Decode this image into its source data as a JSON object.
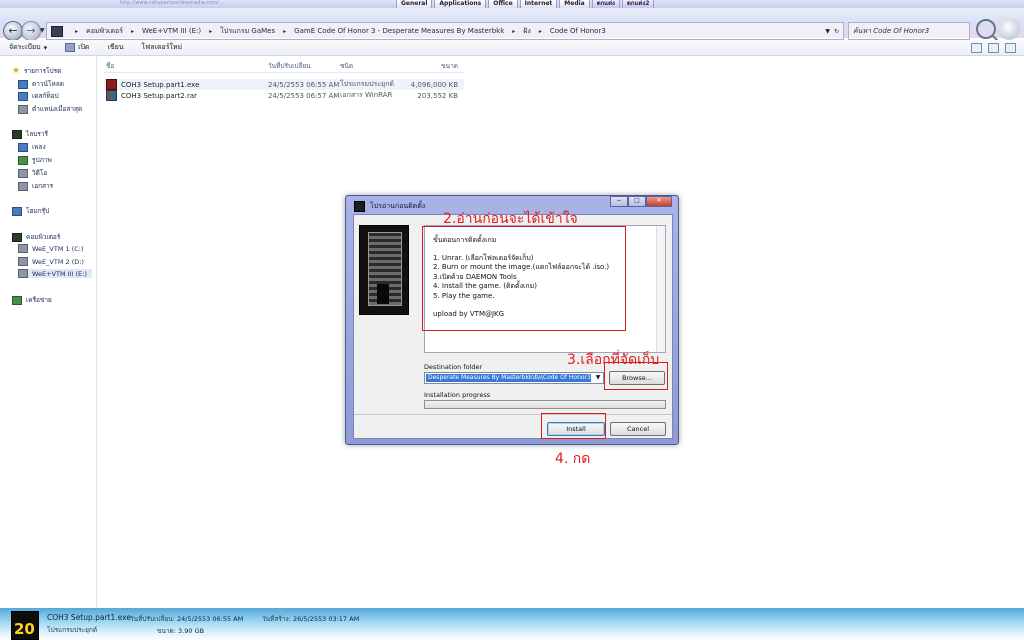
{
  "bookmarks": {
    "faint_text": "http://www.cdhypertoonlinemedia.com/...",
    "tabs": [
      "General",
      "Applications",
      "Office",
      "Internet",
      "Media",
      "ตกแต่ง",
      "ตกแต่ง2"
    ]
  },
  "address_bar": {
    "crumbs": [
      "คอมพิวเตอร์",
      "WeE+VTM III (E:)",
      "โปรแกรม GaMes",
      "GamE Code Of Honor 3 - Desperate Measures By Masterbkk",
      "ฝัง",
      "Code Of Honor3"
    ],
    "search_placeholder": "ค้นหา Code Of Honor3"
  },
  "toolbar": {
    "organize": "จัดระเบียบ",
    "open": "เปิด",
    "burn": "เขียน",
    "new_folder": "โฟลเดอร์ใหม่"
  },
  "nav": {
    "favorites": "รายการโปรด",
    "downloads": "ดาวน์โหลด",
    "desktop": "เดสก์ท็อป",
    "recent": "ตำแหน่งเมื่อล่าสุด",
    "libraries": "ไลบรารี",
    "music": "เพลง",
    "pictures": "รูปภาพ",
    "videos": "วิดีโอ",
    "documents": "เอกสาร",
    "homegroup": "โฮมกรุ๊ป",
    "computer": "คอมพิวเตอร์",
    "drive_c": "WeE_VTM 1 (C:)",
    "drive_d": "WeE_VTM 2 (D:)",
    "drive_e": "WeE+VTM III (E:)",
    "network": "เครือข่าย"
  },
  "file_list": {
    "headers": {
      "name": "ชื่อ",
      "date": "วันที่ปรับเปลี่ยน",
      "type": "ชนิด",
      "size": "ขนาด"
    },
    "rows": [
      {
        "name": "COH3 Setup.part1.exe",
        "date": "24/5/2553 06:55 AM",
        "type": "โปรแกรมประยุกต์",
        "size": "4,096,000 KB"
      },
      {
        "name": "COH3 Setup.part2.rar",
        "date": "24/5/2553 06:57 AM",
        "type": "เอกสาร WinRAR",
        "size": "203,552 KB"
      }
    ]
  },
  "dialog": {
    "title": "โปรอ่านก่อนติดตั้ง",
    "readme": {
      "heading": "ขั้นตอนการติดตั้งเกม",
      "steps": [
        "1. Unrar. (เลือกโฟลเดอร์จัดเก็บ)",
        "2. Burn or mount the image.(แตกไฟล์ออกจะได้ .iso.)",
        "3.เปิดด้วย DAEMON Tools",
        "4. Install the game. (ติดตั้งเกม)",
        "5. Play the game."
      ],
      "upload": "upload by VTM@JKG"
    },
    "destination_label": "Destination folder",
    "destination_value": "Desperate Measures By Masterbkk\\ฝัง\\Code Of Honor3",
    "browse_label": "Browse...",
    "progress_label": "Installation progress",
    "progress": 0,
    "install_label": "Install",
    "cancel_label": "Cancel"
  },
  "annotations": {
    "step2": "2.อ่านก่อนจะได้เข้าใจ",
    "step3": "3.เลือกที่จัดเก็บ",
    "step4": "4. กด"
  },
  "details": {
    "icon_text": "20",
    "name": "COH3 Setup.part1.exe",
    "type": "โปรแกรมประยุกต์",
    "modified_label": "วันที่ปรับเปลี่ยน:",
    "modified_value": "24/5/2553 06:55 AM",
    "size_label": "ขนาด:",
    "size_value": "3.90 GB",
    "created_label": "วันที่สร้าง:",
    "created_value": "26/5/2553 03:17 AM"
  }
}
